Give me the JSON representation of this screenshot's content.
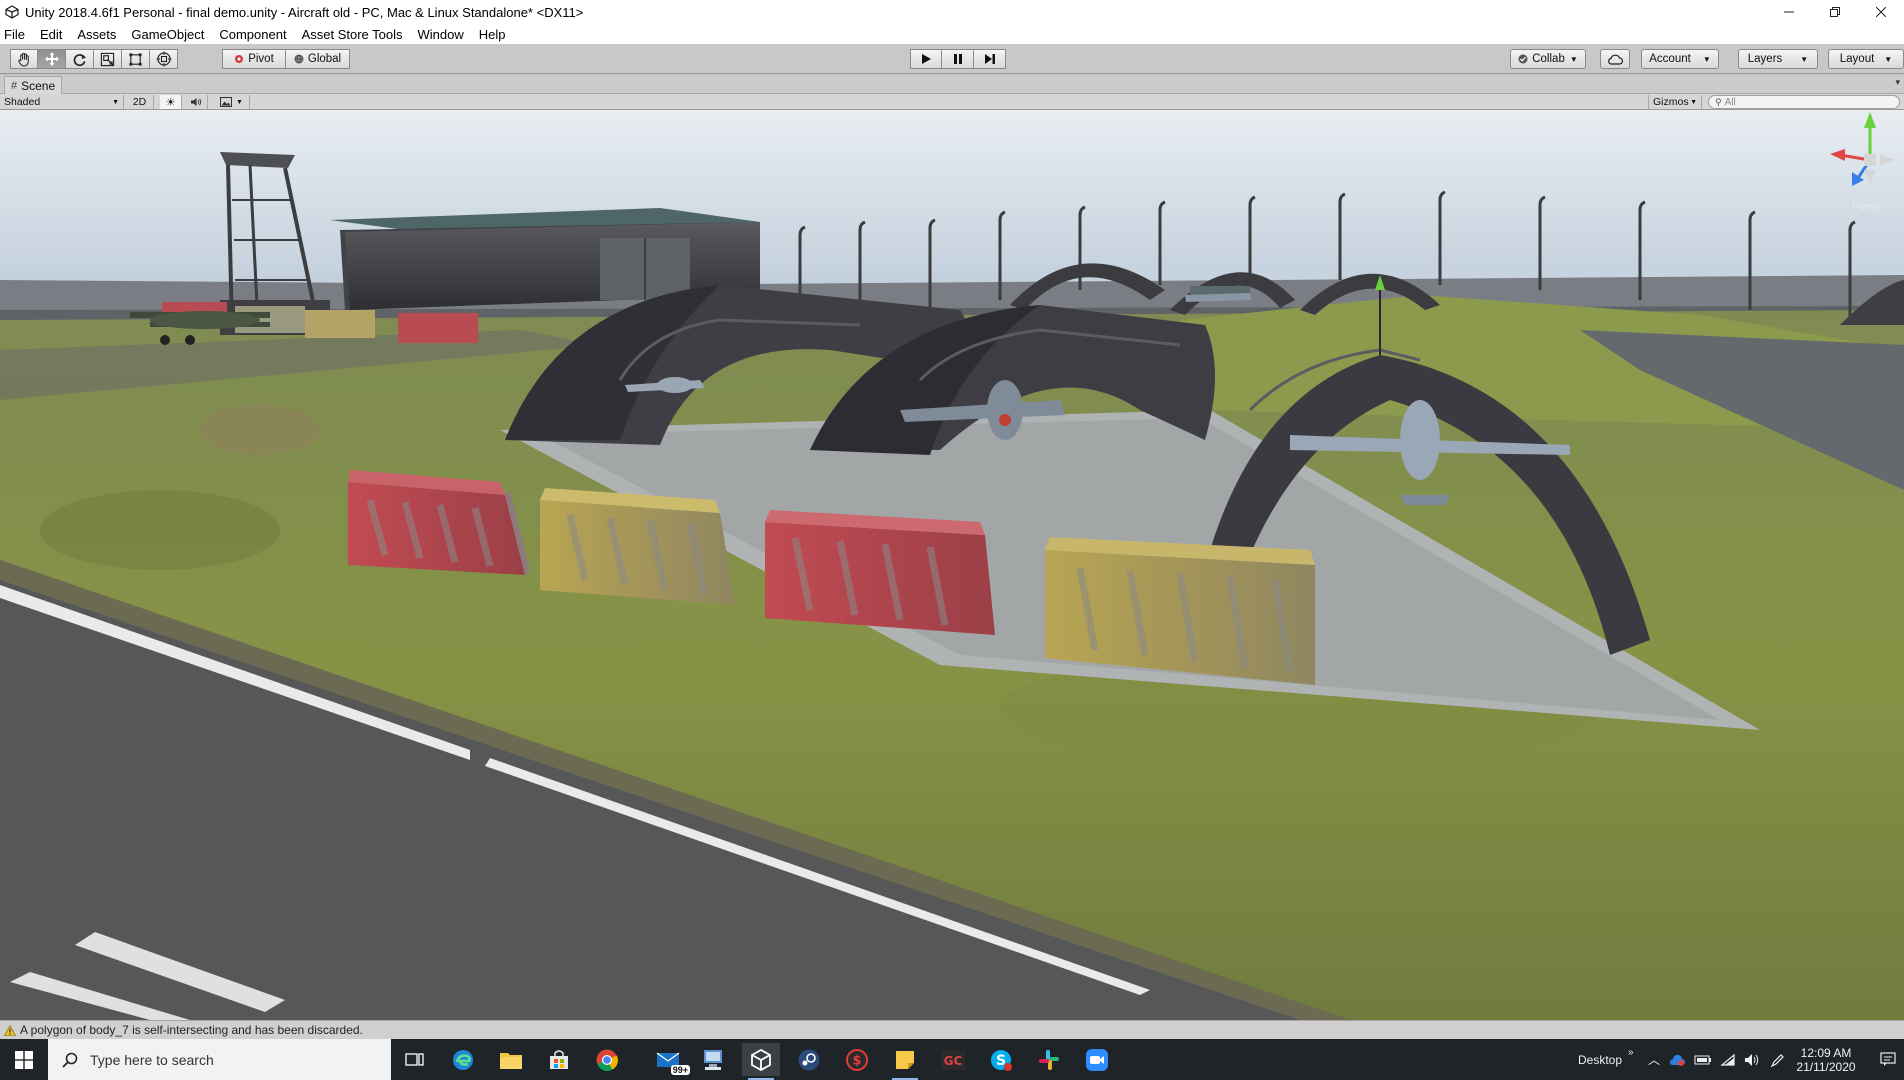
{
  "window": {
    "title": "Unity 2018.4.6f1 Personal - final demo.unity - Aircraft old - PC, Mac & Linux Standalone* <DX11>",
    "controls": [
      "minimize-icon",
      "restore-icon",
      "close-icon"
    ]
  },
  "menubar": {
    "items": [
      "File",
      "Edit",
      "Assets",
      "GameObject",
      "Component",
      "Asset Store Tools",
      "Window",
      "Help"
    ]
  },
  "toolbar": {
    "transform_tools": [
      "hand-icon",
      "move-icon",
      "rotate-icon",
      "scale-icon",
      "rect-tool-icon",
      "transform-tool-icon"
    ],
    "pivot_label": "Pivot",
    "global_label": "Global",
    "playback": [
      "play-icon",
      "pause-icon",
      "step-icon"
    ],
    "collab_label": "Collab",
    "account_label": "Account",
    "layers_label": "Layers",
    "layout_label": "Layout"
  },
  "scene_tab": {
    "label": "Scene"
  },
  "scene_toolbar": {
    "draw_mode": "Shaded",
    "mode_2d": "2D",
    "gizmos_label": "Gizmos",
    "search_placeholder": "All"
  },
  "viewport": {
    "gizmo_label": "Persp"
  },
  "status_bar": {
    "message": "A polygon of body_7 is self-intersecting and has been discarded."
  },
  "taskbar": {
    "search_placeholder": "Type here to search",
    "mail_badge": "99+",
    "desktop_label": "Desktop",
    "time": "12:09 AM",
    "date": "21/11/2020"
  },
  "colors": {
    "accent_selection": "#8e8e8e",
    "taskbar": "#1f2429",
    "warning": "#f0c020"
  }
}
